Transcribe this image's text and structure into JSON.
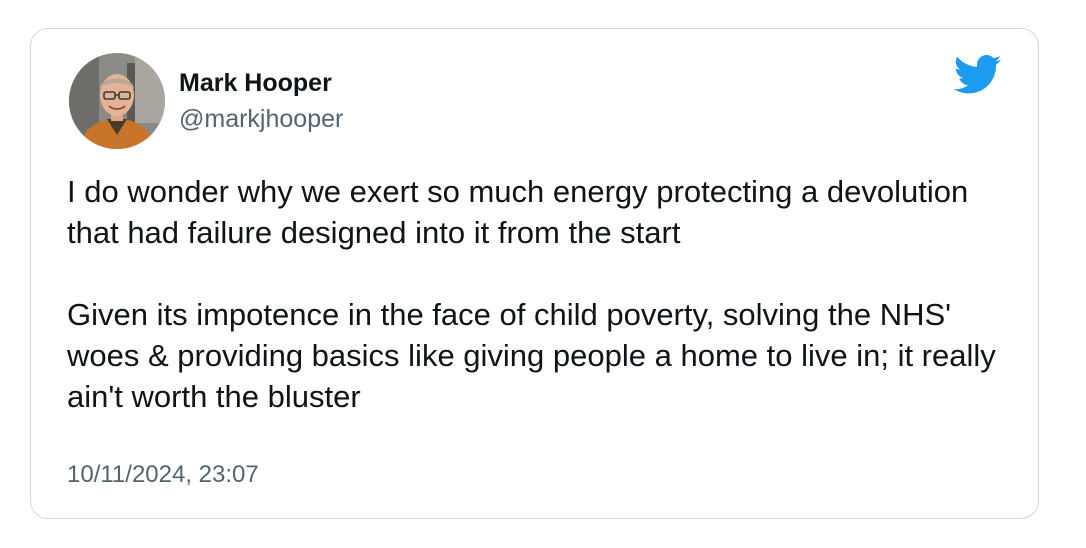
{
  "tweet": {
    "author": {
      "name": "Mark Hooper",
      "handle": "@markjhooper",
      "avatar_icon": "profile-photo"
    },
    "paragraphs": [
      "I do wonder why we exert so much energy protecting a devolution that had failure designed into it from the start",
      "Given its impotence in the face of child poverty, solving the NHS' woes & providing basics like giving people a home to live in; it really ain't worth the bluster"
    ],
    "timestamp": "10/11/2024, 23:07",
    "platform_icon": "twitter-bird-icon"
  },
  "colors": {
    "border": "#cfd9de",
    "text": "#0f1419",
    "secondary_text": "#536471",
    "brand": "#1d9bf0"
  }
}
